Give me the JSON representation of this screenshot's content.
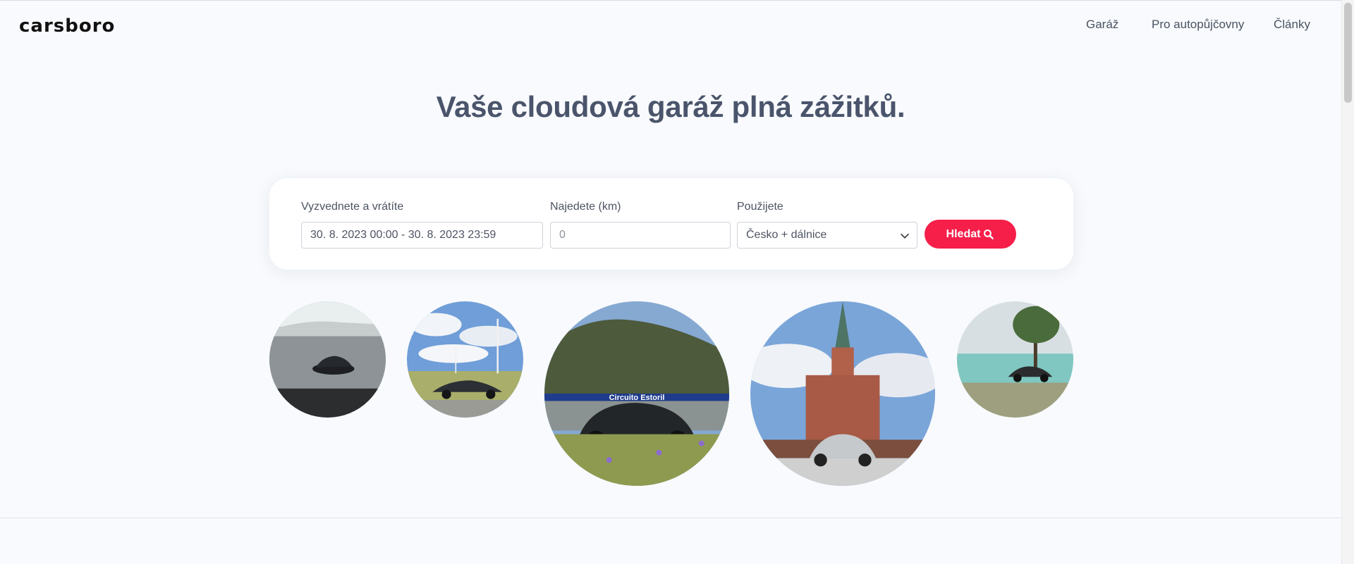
{
  "header": {
    "logo": "carsboro",
    "nav": [
      "Garáž",
      "Pro autopůjčovny",
      "Články"
    ]
  },
  "hero": {
    "title": "Vaše cloudová garáž plná zážitků."
  },
  "search": {
    "pickup_label": "Vyzvednete a vrátíte",
    "pickup_value": "30. 8. 2023 00:00 - 30. 8. 2023 23:59",
    "distance_label": "Najedete (km)",
    "distance_placeholder": "0",
    "usage_label": "Použijete",
    "usage_value": "Česko + dálnice",
    "button_label": "Hledat"
  },
  "photos": {
    "circuit_sign": "Circuito Estoril"
  },
  "colors": {
    "accent": "#f51f4a",
    "heading": "#4a546b",
    "background": "#f8fafd"
  }
}
